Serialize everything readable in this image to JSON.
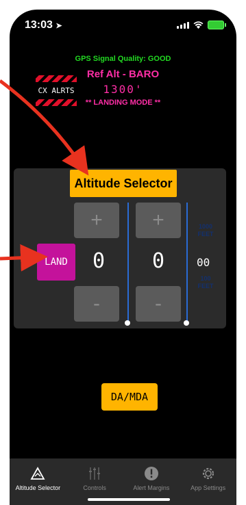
{
  "status": {
    "time": "13:03",
    "location_icon": "location-arrow-icon"
  },
  "header": {
    "gps": "GPS Signal Quality: GOOD",
    "ref_alt": "Ref Alt - BARO",
    "alt_value": "1300'",
    "mode": "** LANDING MODE **",
    "cx_label": "CX ALRTS"
  },
  "selector": {
    "title": "Altitude Selector",
    "land_label": "LAND",
    "plus": "+",
    "minus": "-",
    "digit_thousands": "0",
    "digit_hundreds": "0",
    "digit_tens": "00",
    "unit_top": "1000\nFEET",
    "unit_bottom": "100\nFEET"
  },
  "da_mda_label": "DA/MDA",
  "tabs": [
    {
      "label": "Altitude Selector",
      "icon": "altitude-selector-icon",
      "active": true
    },
    {
      "label": "Controls",
      "icon": "controls-sliders-icon",
      "active": false
    },
    {
      "label": "Alert Margins",
      "icon": "alert-exclamation-icon",
      "active": false
    },
    {
      "label": "App Settings",
      "icon": "gear-icon",
      "active": false
    }
  ],
  "colors": {
    "gps_green": "#22d922",
    "pink": "#ff2ea6",
    "yellow": "#ffb400",
    "land_magenta": "#c4129b",
    "arrow_red": "#e8321f"
  }
}
